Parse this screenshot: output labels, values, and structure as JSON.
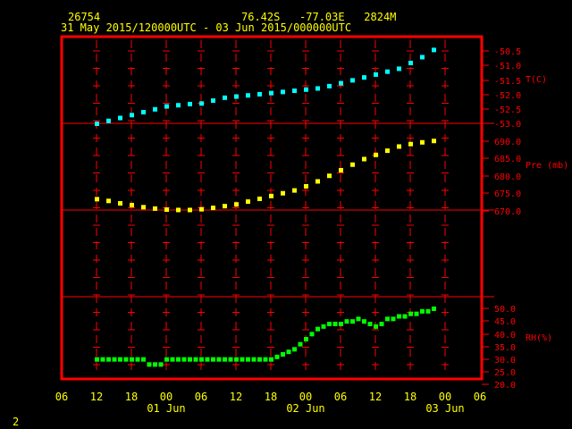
{
  "header": {
    "station_id": "26754",
    "location": "76.42S   -77.03E   2824M",
    "time_range": "31 May 2015/120000UTC - 03 Jun 2015/000000UTC"
  },
  "footer": {
    "page_number": "2"
  },
  "colors": {
    "frame": "#ff0000",
    "axis_text": "#ff0000",
    "x_text": "#ffff00",
    "temp": "#00ffff",
    "pres": "#ffff00",
    "rh": "#00ff00"
  },
  "chart_data": {
    "type": "scatter",
    "x_unit": "hours",
    "x_range": [
      -6,
      54
    ],
    "x_ticks": [
      {
        "x": -6,
        "label": "06"
      },
      {
        "x": 0,
        "label": "12"
      },
      {
        "x": 6,
        "label": "18"
      },
      {
        "x": 12,
        "label": "00"
      },
      {
        "x": 18,
        "label": "06"
      },
      {
        "x": 24,
        "label": "12"
      },
      {
        "x": 30,
        "label": "18"
      },
      {
        "x": 36,
        "label": "00"
      },
      {
        "x": 42,
        "label": "06"
      },
      {
        "x": 48,
        "label": "12"
      },
      {
        "x": 54,
        "label": "18"
      },
      {
        "x": 60,
        "label": "00"
      },
      {
        "x": 66,
        "label": "06"
      }
    ],
    "date_labels": [
      {
        "x": 12,
        "label": "01 Jun"
      },
      {
        "x": 36,
        "label": "02 Jun"
      },
      {
        "x": 60,
        "label": "03 Jun"
      }
    ],
    "panels": [
      {
        "name": "T(C)",
        "ylim": [
          -53.0,
          -50.2
        ],
        "ticks": [
          "-50.5",
          "-51.0",
          "-51.5",
          "-52.0",
          "-52.5",
          "-53.0"
        ],
        "x": [
          0,
          1,
          2,
          3,
          4,
          5,
          6,
          7,
          8,
          9,
          10,
          11,
          12,
          13,
          14,
          15,
          16,
          17,
          18,
          19,
          20,
          21,
          22,
          23,
          24,
          25,
          26,
          27,
          28,
          29,
          30,
          31,
          32,
          33,
          34,
          35,
          36,
          37,
          38,
          39,
          40,
          41,
          42,
          43,
          44,
          45,
          46,
          47,
          48,
          49,
          50,
          51,
          52,
          53,
          54,
          55,
          56,
          57,
          58
        ],
        "values": [
          -53.0,
          -52.95,
          -52.9,
          -52.85,
          -52.8,
          -52.75,
          -52.7,
          -52.65,
          -52.6,
          -52.55,
          -52.5,
          -52.45,
          -52.4,
          -52.38,
          -52.36,
          -52.34,
          -52.32,
          -52.3,
          -52.3,
          -52.25,
          -52.2,
          -52.15,
          -52.1,
          -52.08,
          -52.06,
          -52.04,
          -52.02,
          -52.0,
          -51.98,
          -51.96,
          -51.94,
          -51.92,
          -51.9,
          -51.88,
          -51.86,
          -51.84,
          -51.82,
          -51.8,
          -51.78,
          -51.75,
          -51.7,
          -51.65,
          -51.6,
          -51.55,
          -51.5,
          -51.45,
          -51.4,
          -51.35,
          -51.3,
          -51.25,
          -51.2,
          -51.15,
          -51.1,
          -51.0,
          -50.9,
          -50.8,
          -50.7,
          -50.6,
          -50.45
        ]
      },
      {
        "name": "Pre (mb)",
        "ylim": [
          668,
          692
        ],
        "ticks": [
          "690.0",
          "685.0",
          "680.0",
          "675.0",
          "670.0"
        ],
        "x": [
          0,
          1,
          2,
          3,
          4,
          5,
          6,
          7,
          8,
          9,
          10,
          11,
          12,
          13,
          14,
          15,
          16,
          17,
          18,
          19,
          20,
          21,
          22,
          23,
          24,
          25,
          26,
          27,
          28,
          29,
          30,
          31,
          32,
          33,
          34,
          35,
          36,
          37,
          38,
          39,
          40,
          41,
          42,
          43,
          44,
          45,
          46,
          47,
          48,
          49,
          50,
          51,
          52,
          53,
          54,
          55,
          56,
          57,
          58
        ],
        "values": [
          673.5,
          673.2,
          673.0,
          672.6,
          672.3,
          672.0,
          671.8,
          671.5,
          671.2,
          671.0,
          670.8,
          670.6,
          670.5,
          670.4,
          670.4,
          670.4,
          670.4,
          670.5,
          670.6,
          670.8,
          671.0,
          671.2,
          671.5,
          671.8,
          672.0,
          672.4,
          672.8,
          673.2,
          673.6,
          674.0,
          674.4,
          674.8,
          675.2,
          675.6,
          676.0,
          676.6,
          677.2,
          677.8,
          678.6,
          679.4,
          680.2,
          681.0,
          681.8,
          682.6,
          683.4,
          684.2,
          685.0,
          685.6,
          686.2,
          686.8,
          687.4,
          688.0,
          688.6,
          689.0,
          689.3,
          689.6,
          689.8,
          690.0,
          690.2
        ]
      },
      {
        "name": "RH(%)",
        "ylim": [
          20,
          52
        ],
        "ticks": [
          "50.0",
          "45.0",
          "40.0",
          "35.0",
          "30.0",
          "25.0",
          "20.0"
        ],
        "x": [
          0,
          1,
          2,
          3,
          4,
          5,
          6,
          7,
          8,
          9,
          10,
          11,
          12,
          13,
          14,
          15,
          16,
          17,
          18,
          19,
          20,
          21,
          22,
          23,
          24,
          25,
          26,
          27,
          28,
          29,
          30,
          31,
          32,
          33,
          34,
          35,
          36,
          37,
          38,
          39,
          40,
          41,
          42,
          43,
          44,
          45,
          46,
          47,
          48,
          49,
          50,
          51,
          52,
          53,
          54,
          55,
          56,
          57,
          58
        ],
        "values": [
          30,
          30,
          30,
          30,
          30,
          30,
          30,
          30,
          30,
          28,
          28,
          28,
          30,
          30,
          30,
          30,
          30,
          30,
          30,
          30,
          30,
          30,
          30,
          30,
          30,
          30,
          30,
          30,
          30,
          30,
          30,
          31,
          32,
          33,
          34,
          36,
          38,
          40,
          42,
          43,
          44,
          44,
          44,
          45,
          45,
          46,
          45,
          44,
          43,
          44,
          46,
          46,
          47,
          47,
          48,
          48,
          49,
          49,
          50
        ]
      }
    ]
  }
}
